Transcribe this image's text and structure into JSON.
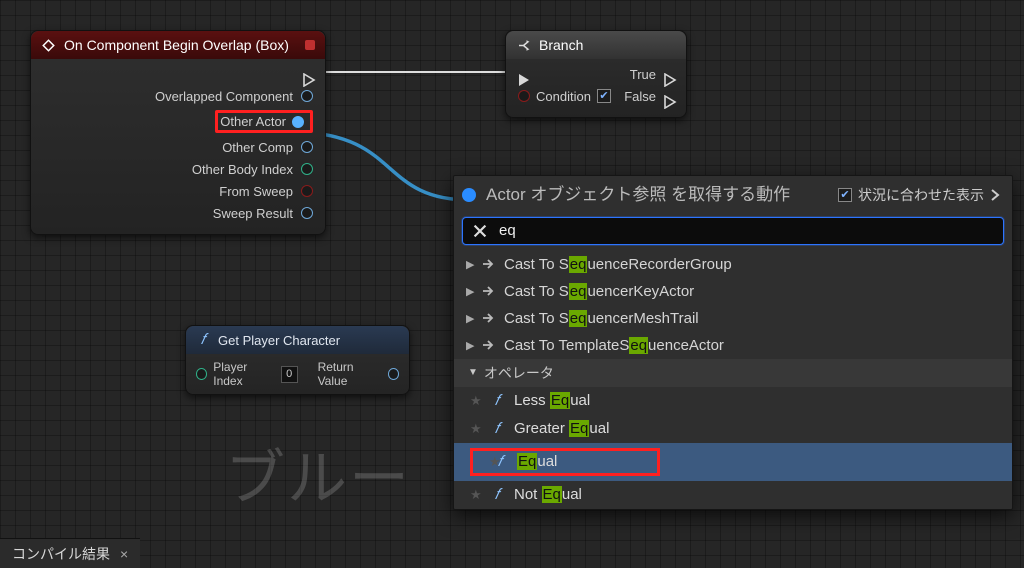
{
  "watermark": "ブルー",
  "event_node": {
    "title": "On Component Begin Overlap (Box)",
    "pins": {
      "overlapped_component": "Overlapped Component",
      "other_actor": "Other Actor",
      "other_comp": "Other Comp",
      "other_body_index": "Other Body Index",
      "from_sweep": "From Sweep",
      "sweep_result": "Sweep Result"
    }
  },
  "branch_node": {
    "title": "Branch",
    "condition": "Condition",
    "true": "True",
    "false": "False"
  },
  "func_node": {
    "title": "Get Player Character",
    "player_index": "Player Index",
    "player_index_value": "0",
    "return_value": "Return Value"
  },
  "context_menu": {
    "title": "Actor オブジェクト参照 を取得する動作",
    "context_label": "状況に合わせた表示",
    "search_value": "eq",
    "items": [
      {
        "kind": "cast",
        "prefix": "Cast To S",
        "hl": "eq",
        "suffix": "uenceRecorderGroup"
      },
      {
        "kind": "cast",
        "prefix": "Cast To S",
        "hl": "eq",
        "suffix": "uencerKeyActor"
      },
      {
        "kind": "cast",
        "prefix": "Cast To S",
        "hl": "eq",
        "suffix": "uencerMeshTrail"
      },
      {
        "kind": "cast",
        "prefix": "Cast To TemplateS",
        "hl": "eq",
        "suffix": "uenceActor"
      }
    ],
    "category": "オペレータ",
    "funcs": [
      {
        "prefix": "Less ",
        "hl": "Eq",
        "suffix": "ual",
        "selected": false
      },
      {
        "prefix": "Greater ",
        "hl": "Eq",
        "suffix": "ual",
        "selected": false
      },
      {
        "prefix": "",
        "hl": "Eq",
        "suffix": "ual",
        "selected": true
      },
      {
        "prefix": "Not ",
        "hl": "Eq",
        "suffix": "ual",
        "selected": false
      }
    ]
  },
  "bottom_tab": {
    "label": "コンパイル結果"
  }
}
